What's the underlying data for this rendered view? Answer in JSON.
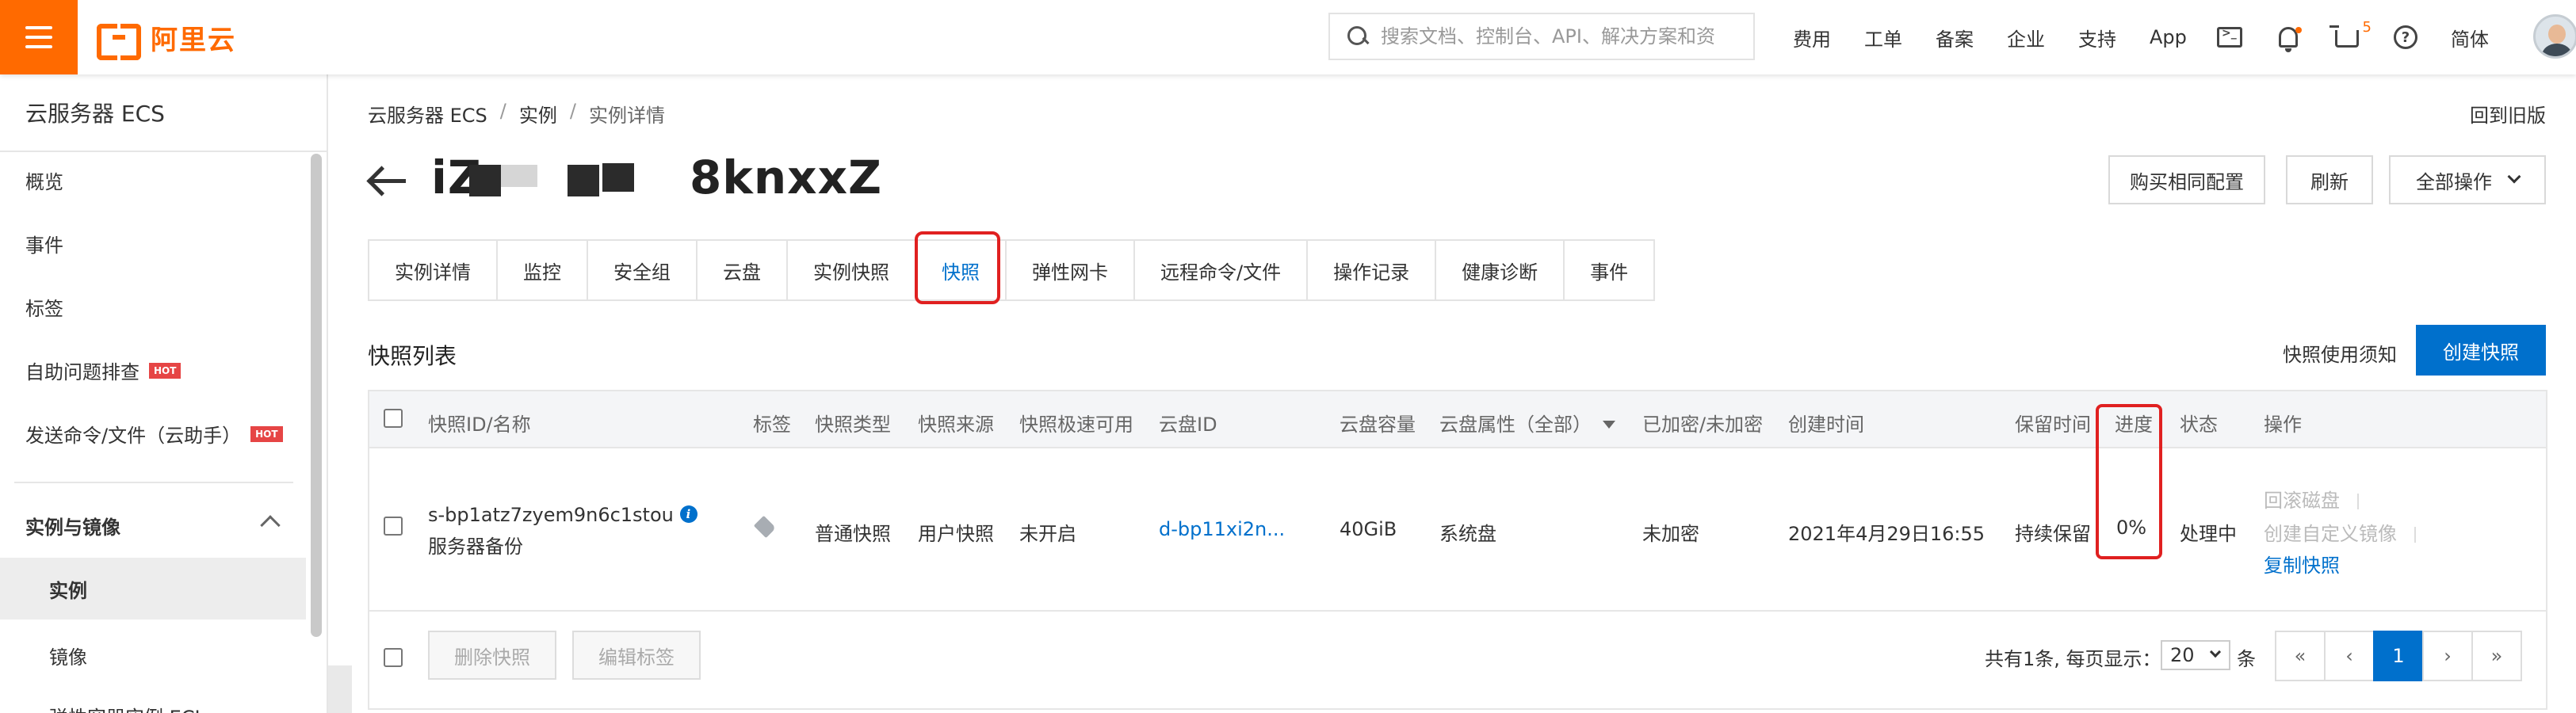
{
  "topbar": {
    "logo_text": "阿里云",
    "search_placeholder": "搜索文档、控制台、API、解决方案和资",
    "nav": [
      "费用",
      "工单",
      "备案",
      "企业",
      "支持",
      "App"
    ],
    "cart_count": "5",
    "lang": "简体",
    "brand_color": "#ff6a00"
  },
  "sidebar": {
    "title": "云服务器 ECS",
    "items": [
      "概览",
      "事件",
      "标签",
      "自助问题排查",
      "发送命令/文件（云助手）"
    ],
    "hot_label": "HOT",
    "group": "实例与镜像",
    "sub_items": [
      "实例",
      "镜像",
      "弹性容器实例 ECI"
    ]
  },
  "breadcrumb": {
    "items": [
      "云服务器 ECS",
      "实例",
      "实例详情"
    ],
    "sep": "/"
  },
  "back_to_old": "回到旧版",
  "instance": {
    "title_visible": "iZ",
    "title_visible_mid": "8knxxZ"
  },
  "actions": {
    "buy_same": "购买相同配置",
    "refresh": "刷新",
    "all_ops": "全部操作"
  },
  "tabs": [
    "实例详情",
    "监控",
    "安全组",
    "云盘",
    "实例快照",
    "快照",
    "弹性网卡",
    "远程命令/文件",
    "操作记录",
    "健康诊断",
    "事件"
  ],
  "snapshot": {
    "section_title": "快照列表",
    "notice_link": "快照使用须知",
    "create_button": "创建快照",
    "columns": [
      "快照ID/名称",
      "标签",
      "快照类型",
      "快照来源",
      "快照极速可用",
      "云盘ID",
      "云盘容量",
      "云盘属性（全部）",
      "已加密/未加密",
      "创建时间",
      "保留时间",
      "进度",
      "状态",
      "操作"
    ],
    "row": {
      "id": "s-bp1atz7zyem9n6c1stou",
      "name": "服务器备份",
      "type": "普通快照",
      "source": "用户快照",
      "fast_available": "未开启",
      "disk_id": "d-bp11xi2n...",
      "capacity": "40GiB",
      "disk_attr": "系统盘",
      "encryption": "未加密",
      "created": "2021年4月29日16:55",
      "retention": "持续保留",
      "progress": "0%",
      "status": "处理中",
      "ops": [
        "回滚磁盘",
        "创建自定义镜像",
        "复制快照"
      ]
    },
    "footer": {
      "delete": "删除快照",
      "edit_tags": "编辑标签",
      "total_text": "共有1条, 每页显示：",
      "page_size": "20",
      "unit": "条"
    },
    "pager": [
      "«",
      "‹",
      "1",
      "›",
      "»"
    ]
  },
  "accent": "#0070cc",
  "highlight_color": "#e02020"
}
